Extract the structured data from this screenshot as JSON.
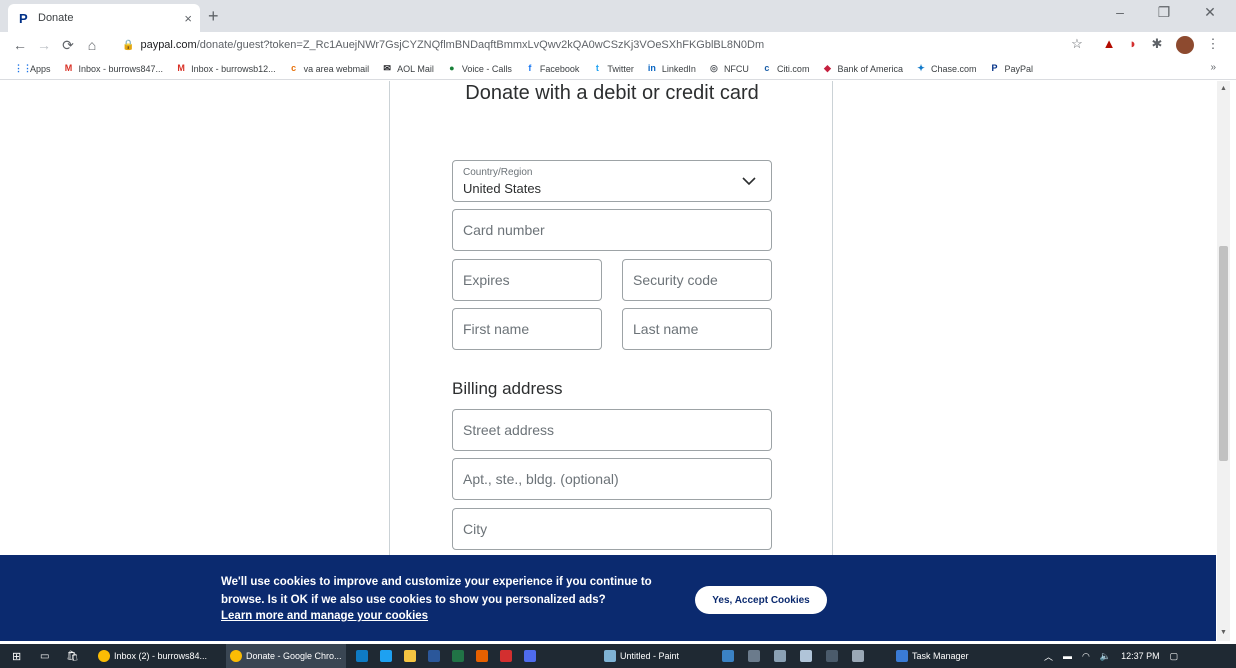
{
  "browser": {
    "tab_title": "Donate",
    "tab_close": "×",
    "new_tab": "+",
    "url_host": "paypal.com",
    "url_path": "/donate/guest?token=Z_Rc1AuejNWr7GsjCYZNQflmBNDaqftBmmxLvQwv2kQA0wCSzKj3VOeSXhFKGblBL8N0Dm",
    "window_controls": {
      "minimize": "–",
      "restore": "❐",
      "close": "✕"
    },
    "bookmarks": [
      {
        "label": "Apps",
        "icon": "apps-grid-icon",
        "color": "#1a73e8",
        "glyph": "⋮⋮"
      },
      {
        "label": "Inbox - burrows847...",
        "icon": "gmail-icon",
        "color": "#d93025",
        "glyph": "M"
      },
      {
        "label": "Inbox - burrowsb12...",
        "icon": "gmail-icon",
        "color": "#d93025",
        "glyph": "M"
      },
      {
        "label": "va area webmail",
        "icon": "webmail-icon",
        "color": "#e8710a",
        "glyph": "c"
      },
      {
        "label": "AOL Mail",
        "icon": "aol-icon",
        "color": "#202124",
        "glyph": "✉"
      },
      {
        "label": "Voice - Calls",
        "icon": "voice-icon",
        "color": "#188038",
        "glyph": "●"
      },
      {
        "label": "Facebook",
        "icon": "facebook-icon",
        "color": "#1877f2",
        "glyph": "f"
      },
      {
        "label": "Twitter",
        "icon": "twitter-icon",
        "color": "#1da1f2",
        "glyph": "t"
      },
      {
        "label": "LinkedIn",
        "icon": "linkedin-icon",
        "color": "#0a66c2",
        "glyph": "in"
      },
      {
        "label": "NFCU",
        "icon": "nfcu-icon",
        "color": "#5f6368",
        "glyph": "◎"
      },
      {
        "label": "Citi.com",
        "icon": "citi-icon",
        "color": "#1a5ea8",
        "glyph": "c"
      },
      {
        "label": "Bank of America",
        "icon": "boa-icon",
        "color": "#c5203f",
        "glyph": "◆"
      },
      {
        "label": "Chase.com",
        "icon": "chase-icon",
        "color": "#117aca",
        "glyph": "✦"
      },
      {
        "label": "PayPal",
        "icon": "paypal-icon",
        "color": "#003087",
        "glyph": "P"
      }
    ],
    "bookmarks_more": "»"
  },
  "form": {
    "heading": "Donate with a debit or credit card",
    "country_label": "Country/Region",
    "country_value": "United States",
    "card_number_placeholder": "Card number",
    "expires_placeholder": "Expires",
    "security_code_placeholder": "Security code",
    "first_name_placeholder": "First name",
    "last_name_placeholder": "Last name",
    "billing_heading": "Billing address",
    "street_placeholder": "Street address",
    "apt_placeholder": "Apt., ste., bldg. (optional)",
    "city_placeholder": "City"
  },
  "cookie_banner": {
    "text": "We'll use cookies to improve and customize your experience if you continue to browse. Is it OK if we also use cookies to show you personalized ads?",
    "link": "Learn more and manage your cookies",
    "accept_label": "Yes, Accept Cookies"
  },
  "taskbar": {
    "items": [
      {
        "label": "Inbox (2) - burrows84...",
        "active": false
      },
      {
        "label": "Donate - Google Chro...",
        "active": true
      },
      {
        "label": "Untitled - Paint",
        "active": false
      },
      {
        "label": "Task Manager",
        "active": false
      }
    ],
    "clock": "12:37 PM"
  },
  "colors": {
    "paypal_blue": "#003087",
    "banner_bg": "#0b2a6f",
    "field_border": "#9da3a6"
  }
}
